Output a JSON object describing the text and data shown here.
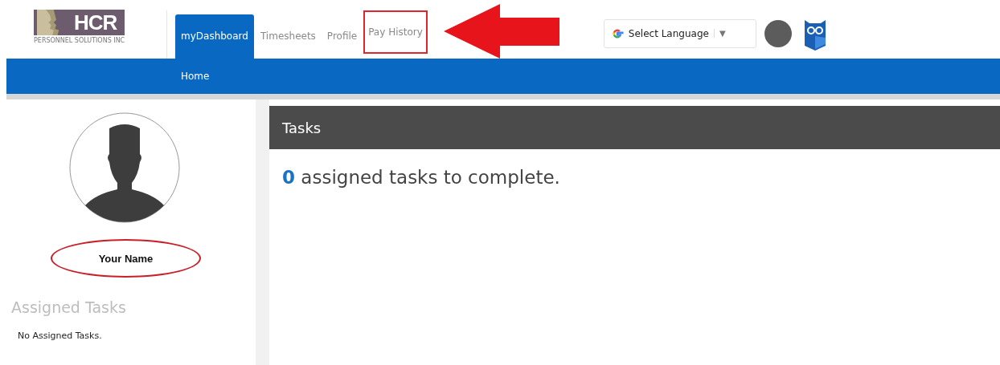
{
  "logo": {
    "text": "HCR",
    "tagline": "PERSONNEL SOLUTIONS INC"
  },
  "tabs": [
    {
      "label": "myDashboard",
      "selected": true,
      "highlighted": false
    },
    {
      "label": "Timesheets",
      "selected": false,
      "highlighted": false
    },
    {
      "label": "Profile",
      "selected": false,
      "highlighted": false
    },
    {
      "label": "Pay History",
      "selected": false,
      "highlighted": true
    }
  ],
  "pointer_arrow": true,
  "language_select": {
    "label": "Select Language",
    "caret": "▼"
  },
  "subnav": [
    {
      "label": "Home",
      "selected": false
    }
  ],
  "profile": {
    "name": "Your Name",
    "name_highlighted": true
  },
  "assigned_tasks": {
    "heading": "Assigned Tasks",
    "empty_text": "No Assigned Tasks."
  },
  "tasks_panel": {
    "title": "Tasks",
    "count": "0",
    "summary": "assigned tasks to complete."
  }
}
